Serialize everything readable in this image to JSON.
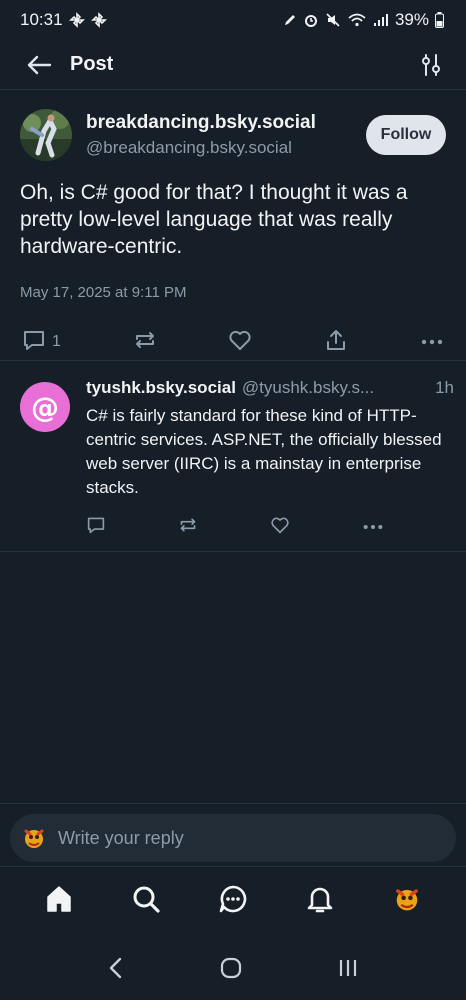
{
  "status_bar": {
    "time": "10:31",
    "battery": "39%"
  },
  "header": {
    "title": "Post"
  },
  "post": {
    "author_name": "breakdancing.bsky.social",
    "author_handle": "@breakdancing.bsky.social",
    "follow_label": "Follow",
    "text": "Oh, is C# good for that? I thought it was a pretty low-level language that was really hardware-centric.",
    "date": "May 17, 2025 at 9:11 PM",
    "reply_count": "1"
  },
  "reply": {
    "author_name": "tyushk.bsky.social",
    "author_handle": "@tyushk.bsky.s...",
    "time": "1h",
    "avatar_glyph": "@",
    "text": "C# is fairly standard for these kind of HTTP-centric services. ASP.NET, the officially blessed web server (IIRC) is a mainstay in enterprise stacks."
  },
  "composer": {
    "placeholder": "Write your reply"
  },
  "icons": {
    "accent": "#8c9baa",
    "background": "#161e27"
  }
}
